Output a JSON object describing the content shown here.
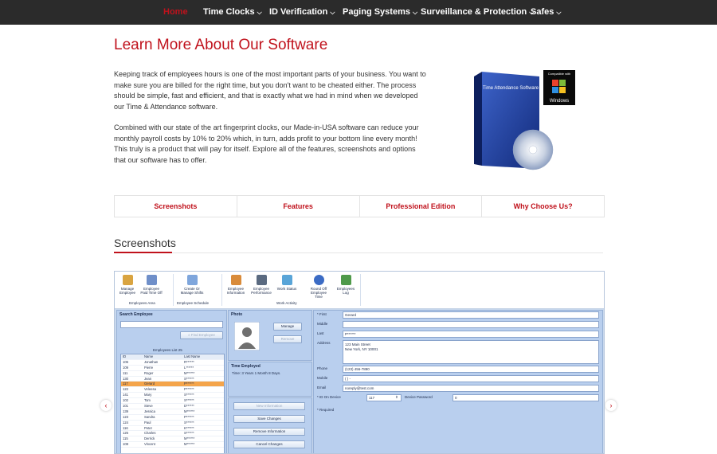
{
  "nav": {
    "items": [
      {
        "label": "Home",
        "dropdown": false,
        "active": true
      },
      {
        "label": "Time Clocks",
        "dropdown": true
      },
      {
        "label": "ID Verification",
        "dropdown": true
      },
      {
        "label": "Paging Systems",
        "dropdown": true
      },
      {
        "label": "Surveillance & Protection",
        "dropdown": true
      },
      {
        "label": "Safes",
        "dropdown": true
      }
    ]
  },
  "main": {
    "title": "Learn More About Our Software",
    "paragraphs": [
      "Keeping track of employees hours is one of the most important parts of your business. You want to make sure you are billed for the right time, but you don't want to be cheated either. The process should be simple, fast and efficient, and that is exactly what we had in mind when we developed our Time & Attendance software.",
      "Combined with our state of the art fingerprint clocks, our Made-in-USA software can reduce your monthly payroll costs by 10% to 20% which, in turn, adds profit to your bottom line every month! This truly is a product that will pay for itself. Explore all of the features, screenshots and options that our software has to offer."
    ],
    "product_box": {
      "box_label": "Time Attendance Software",
      "badge_top": "Compatible with",
      "badge_bottom": "Windows"
    }
  },
  "tabs": [
    "Screenshots",
    "Features",
    "Professional Edition",
    "Why Choose Us?"
  ],
  "screenshots": {
    "title": "Screenshots",
    "prev_arrow": "‹",
    "next_arrow": "›",
    "app": {
      "ribbon": {
        "buttons": [
          {
            "label": "Manage Employee"
          },
          {
            "label": "Employee Paid Time Off"
          },
          {
            "label": "Create Or Manage Shifts"
          },
          {
            "label": "Employee Information"
          },
          {
            "label": "Employee Performance"
          },
          {
            "label": "Work Status"
          },
          {
            "label": "Round Off Employee Time"
          },
          {
            "label": "Employees Log"
          }
        ],
        "groups": [
          "Employees Area",
          "Employee Schedule",
          "Work Activity"
        ]
      },
      "search": {
        "header": "Search Employee",
        "find_button": "Find Employee"
      },
      "grid": {
        "caption": "Employees List 25",
        "columns": [
          "ID",
          "Name",
          "Last Name"
        ],
        "rows": [
          [
            "106",
            "Jonathan",
            "R******"
          ],
          [
            "109",
            "Pierre",
            "L******"
          ],
          [
            "111",
            "Roger",
            "M******"
          ],
          [
            "130",
            "Jean",
            "S******"
          ],
          [
            "117",
            "Gerard",
            "P******"
          ],
          [
            "122",
            "Veleesa",
            "P******"
          ],
          [
            "141",
            "Mary",
            "S******"
          ],
          [
            "102",
            "Tom",
            "S******"
          ],
          [
            "101",
            "Steve",
            "D******"
          ],
          [
            "139",
            "Jessica",
            "M******"
          ],
          [
            "123",
            "Sandra",
            "P******"
          ],
          [
            "124",
            "Paul",
            "S******"
          ],
          [
            "116",
            "Peter",
            "K******"
          ],
          [
            "125",
            "Charles",
            "S******"
          ],
          [
            "115",
            "Derrick",
            "M******"
          ],
          [
            "108",
            "Vincent",
            "M******"
          ]
        ],
        "selected_index": 4
      },
      "photo": {
        "header": "Photo",
        "manage": "Manage",
        "remove": "Remove"
      },
      "time_employed": {
        "header": "Time Employed",
        "value": "Time: 3 Years 1 Month 8 Days."
      },
      "actions": [
        "New Information",
        "Save Changes",
        "Remove Information",
        "Cancel Changes"
      ],
      "form": {
        "first_label": "* First",
        "first": "Gerard",
        "middle_label": "Middle",
        "middle": "",
        "last_label": "Last",
        "last": "P******",
        "address_label": "Address",
        "address_1": "123 Main Street",
        "address_2": "New York, NY 10001",
        "phone_label": "Phone",
        "phone": "(123) 456-7890",
        "mobile_label": "Mobile",
        "mobile": "(  )   -",
        "email_label": "Email",
        "email": "noreply@test.com",
        "device_label": "* ID On Device",
        "device": "117",
        "password_label": "Device Password",
        "password": "0",
        "required": "* Required"
      }
    }
  }
}
